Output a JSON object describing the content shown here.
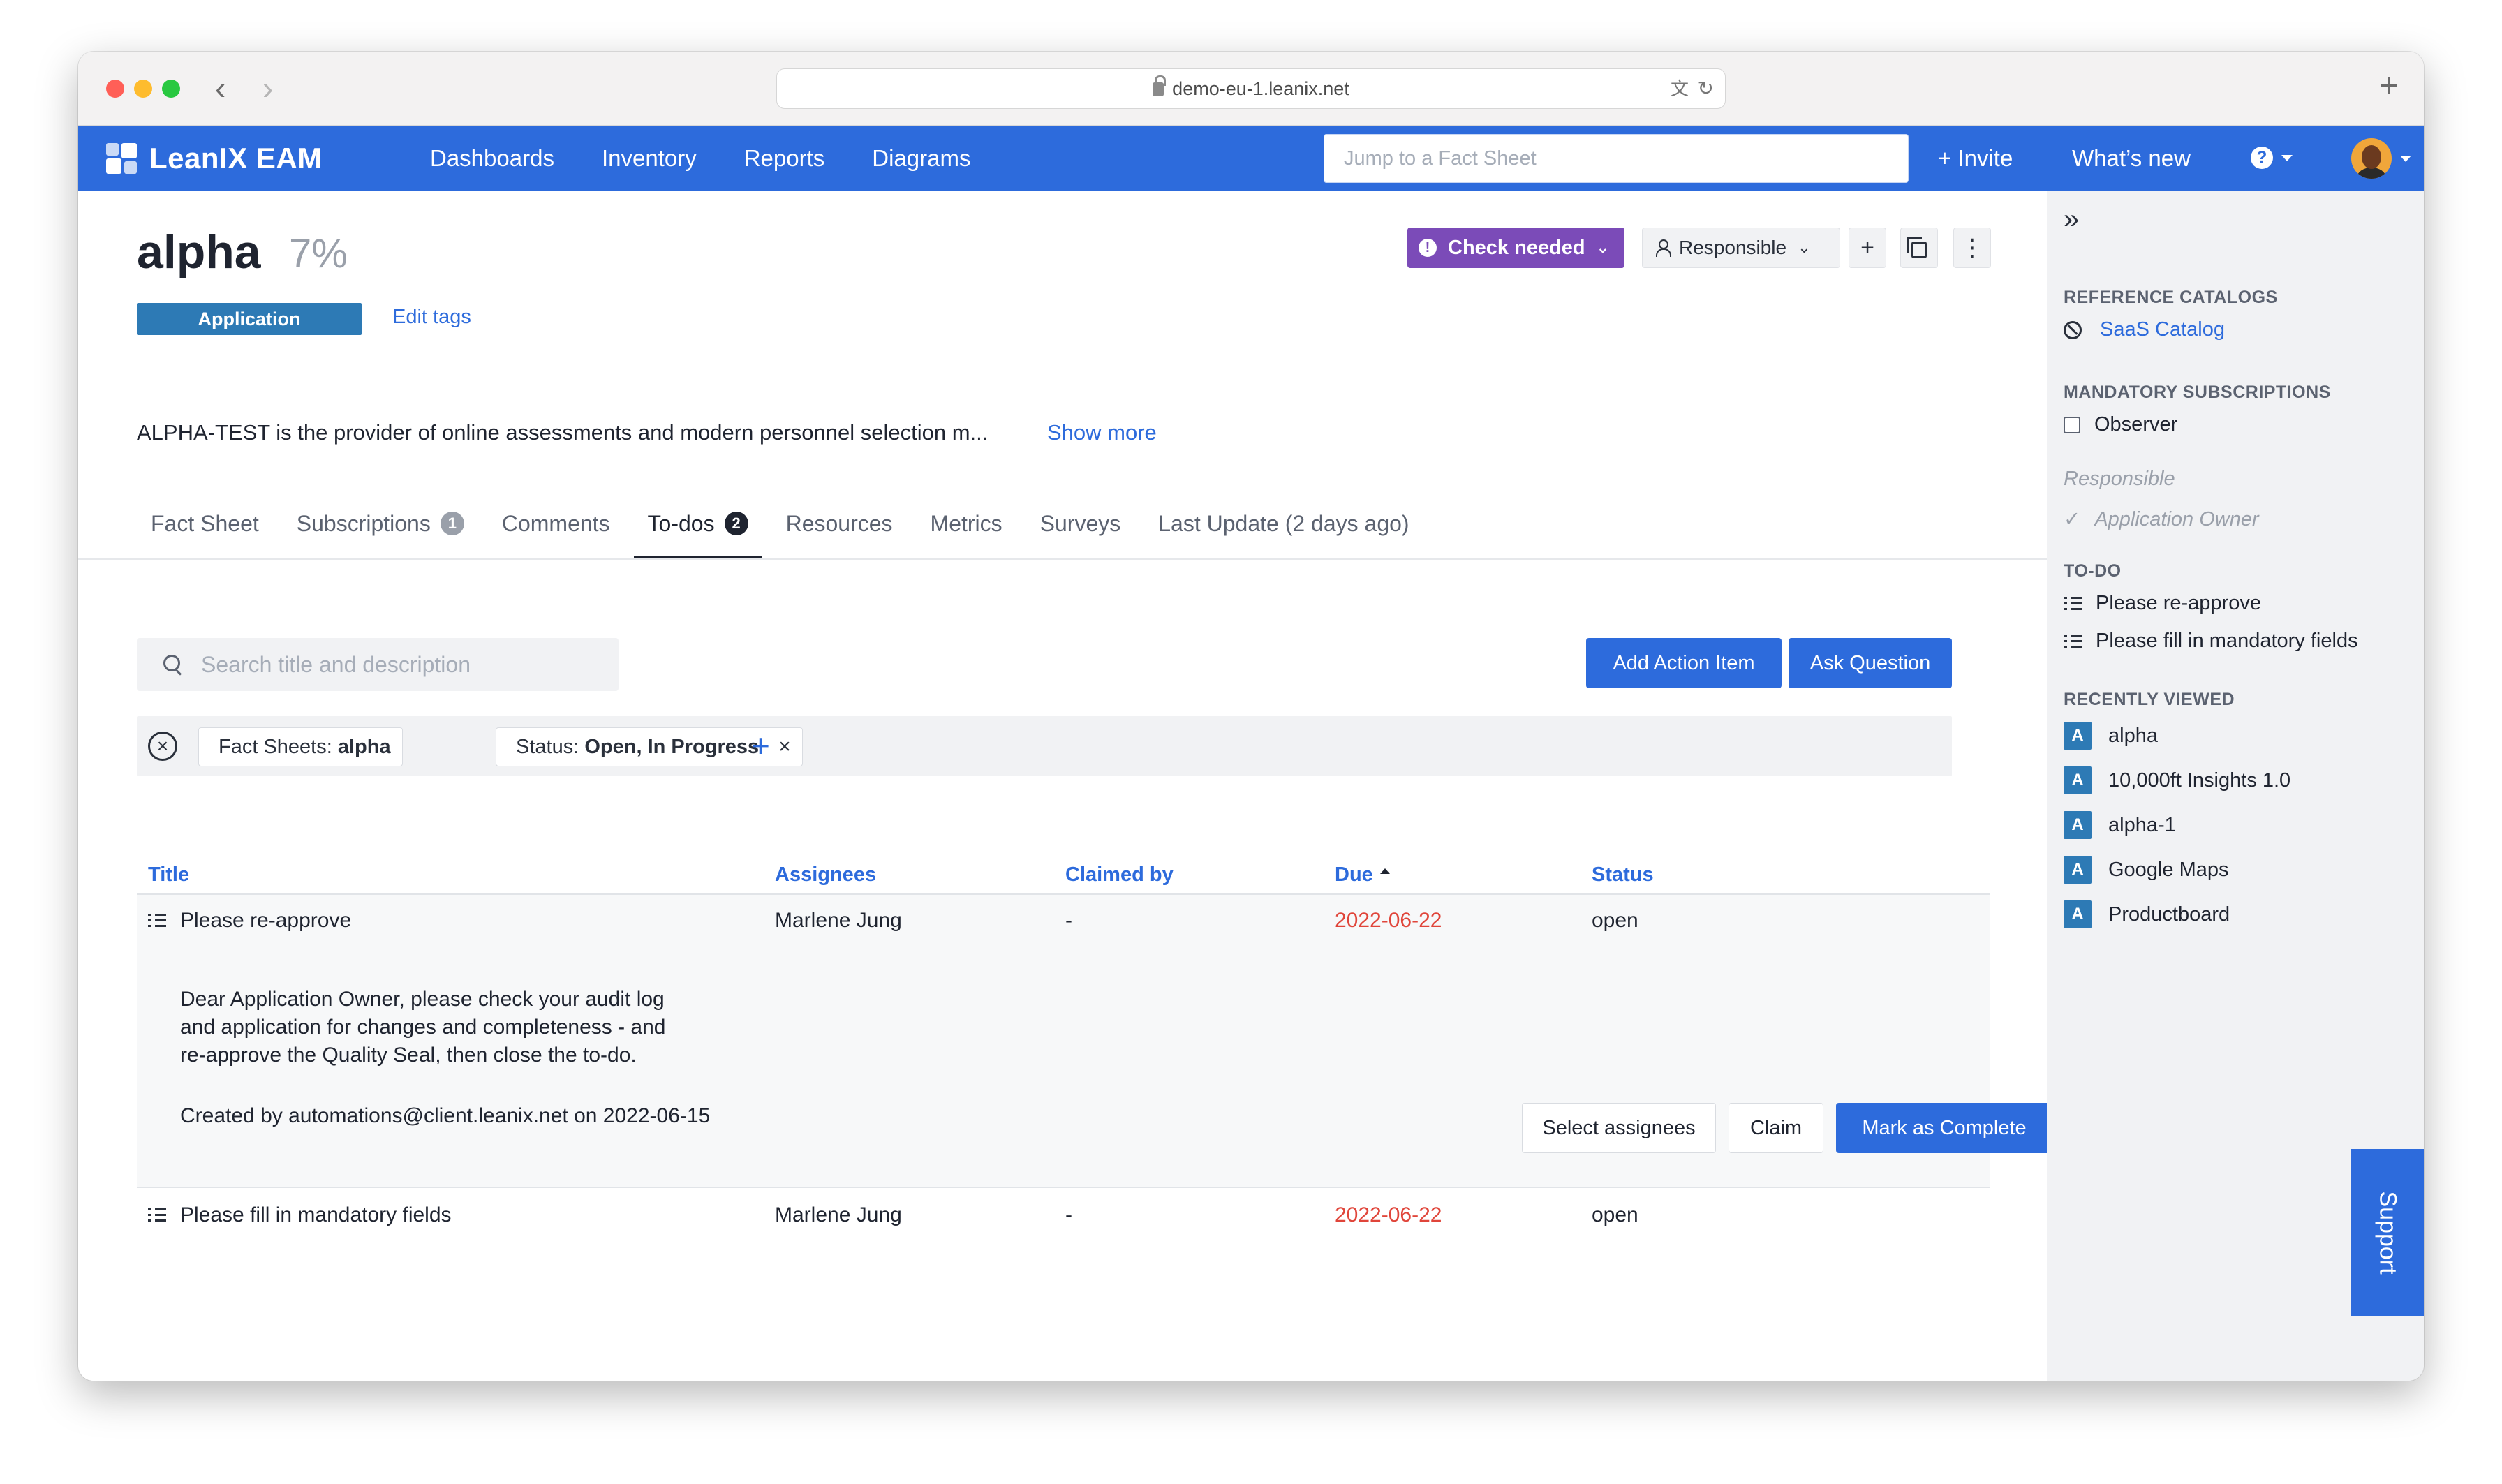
{
  "browser": {
    "url": "demo-eu-1.leanix.net"
  },
  "header": {
    "logo_text": "LeanIX EAM",
    "nav": [
      "Dashboards",
      "Inventory",
      "Reports",
      "Diagrams"
    ],
    "jump_placeholder": "Jump to a Fact Sheet",
    "invite_label": "+ Invite",
    "whats_new_label": "What’s new",
    "help_label": "?"
  },
  "factsheet": {
    "name": "alpha",
    "completion": "7%",
    "type_badge": "Application",
    "edit_tags_label": "Edit tags",
    "description": "ALPHA-TEST is the provider of online assessments and modern personnel selection m...",
    "show_more_label": "Show more",
    "quality_status": "Check needed",
    "responsible_label": "Responsible"
  },
  "tabs": [
    {
      "label": "Fact Sheet",
      "count": null
    },
    {
      "label": "Subscriptions",
      "count": "1"
    },
    {
      "label": "Comments",
      "count": null
    },
    {
      "label": "To-dos",
      "count": "2"
    },
    {
      "label": "Resources",
      "count": null
    },
    {
      "label": "Metrics",
      "count": null
    },
    {
      "label": "Surveys",
      "count": null
    },
    {
      "label": "Last Update (2 days ago)",
      "count": null
    }
  ],
  "todos": {
    "search_placeholder": "Search title and description",
    "add_action_label": "Add Action Item",
    "ask_question_label": "Ask Question",
    "filters": {
      "fact_sheets_key": "Fact Sheets:",
      "fact_sheets_value": "alpha",
      "status_key": "Status:",
      "status_value": "Open,  In Progress",
      "remove_glyph": "×",
      "add_glyph": "+",
      "clear_glyph": "×"
    },
    "columns": {
      "title": "Title",
      "assignees": "Assignees",
      "claimed_by": "Claimed by",
      "due": "Due",
      "status": "Status"
    },
    "rows": [
      {
        "title": "Please re-approve",
        "assignees": "Marlene Jung",
        "claimed_by": "-",
        "due": "2022-06-22",
        "status": "open",
        "description_lines": [
          "Dear Application Owner, please check your audit log",
          "and application for changes and completeness - and",
          "re-approve the Quality Seal, then close the to-do."
        ],
        "created": "Created by automations@client.leanix.net on 2022-06-15",
        "select_assignees_label": "Select assignees",
        "claim_label": "Claim",
        "mark_complete_label": "Mark as Complete"
      },
      {
        "title": "Please fill in mandatory fields",
        "assignees": "Marlene Jung",
        "claimed_by": "-",
        "due": "2022-06-22",
        "status": "open"
      }
    ]
  },
  "sidebar": {
    "reference_catalogs_heading": "REFERENCE CATALOGS",
    "saas_catalog": "SaaS Catalog",
    "mandatory_subscriptions_heading": "MANDATORY SUBSCRIPTIONS",
    "observer": "Observer",
    "responsible": "Responsible",
    "application_owner": "Application Owner",
    "todo_heading": "TO-DO",
    "todo_items": [
      "Please re-approve",
      "Please fill in mandatory fields"
    ],
    "recently_viewed_heading": "RECENTLY VIEWED",
    "recent_items": [
      {
        "badge": "A",
        "label": "alpha"
      },
      {
        "badge": "A",
        "label": "10,000ft Insights 1.0"
      },
      {
        "badge": "A",
        "label": "alpha-1"
      },
      {
        "badge": "A",
        "label": "Google Maps"
      },
      {
        "badge": "A",
        "label": "Productboard"
      }
    ]
  },
  "support_label": "Support",
  "colors": {
    "brand_blue": "#2d6bdc",
    "check_needed_purple": "#7b4bb8",
    "due_red": "#e0453a",
    "application_badge": "#2d7ab5"
  }
}
